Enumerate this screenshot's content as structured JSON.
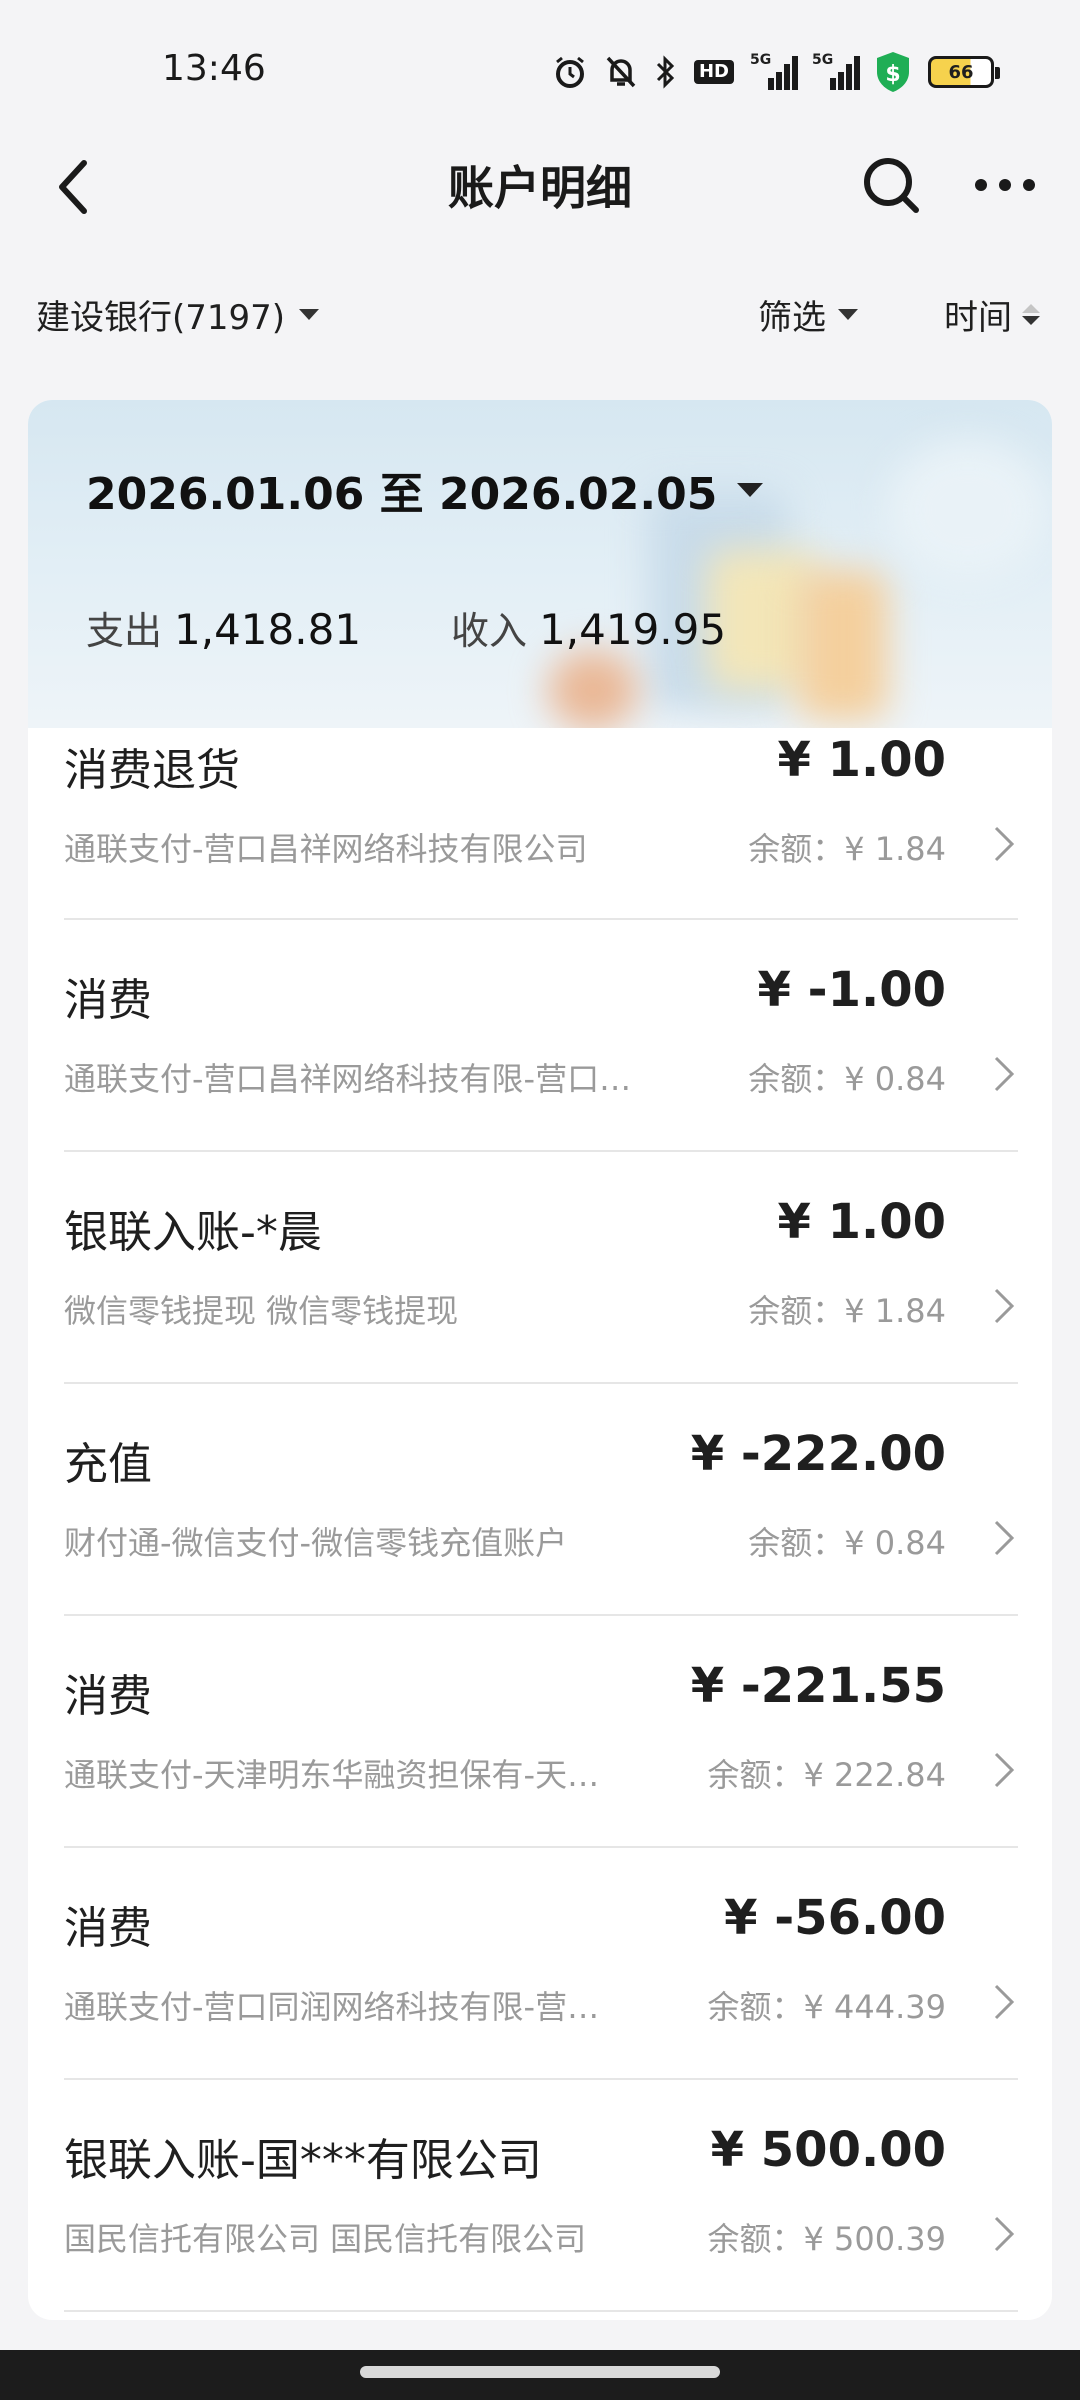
{
  "status_bar": {
    "time": "13:46",
    "battery": "66",
    "network1": "5G",
    "network2": "5G",
    "hd": "HD"
  },
  "header": {
    "title": "账户明细"
  },
  "filters": {
    "account": "建设银行(7197)",
    "filter_label": "筛选",
    "time_label": "时间"
  },
  "summary": {
    "date_range": "2026.01.06 至 2026.02.05",
    "expense_label": "支出",
    "expense_value": "1,418.81",
    "income_label": "收入",
    "income_value": "1,419.95"
  },
  "transactions": [
    {
      "title": "消费退货",
      "amount": "¥ 1.00",
      "desc": "通联支付-营口昌祥网络科技有限公司",
      "balance": "余额：¥ 1.84"
    },
    {
      "title": "消费",
      "amount": "¥ -1.00",
      "desc": "通联支付-营口昌祥网络科技有限-营口…",
      "balance": "余额：¥ 0.84"
    },
    {
      "title": "银联入账-*晨",
      "amount": "¥ 1.00",
      "desc": "微信零钱提现 微信零钱提现",
      "balance": "余额：¥ 1.84"
    },
    {
      "title": "充值",
      "amount": "¥ -222.00",
      "desc": "财付通-微信支付-微信零钱充值账户",
      "balance": "余额：¥ 0.84"
    },
    {
      "title": "消费",
      "amount": "¥ -221.55",
      "desc": "通联支付-天津明东华融资担保有-天津…",
      "balance": "余额：¥ 222.84"
    },
    {
      "title": "消费",
      "amount": "¥ -56.00",
      "desc": "通联支付-营口同润网络科技有限-营口…",
      "balance": "余额：¥ 444.39"
    },
    {
      "title": "银联入账-国***有限公司",
      "amount": "¥ 500.00",
      "desc": "国民信托有限公司 国民信托有限公司",
      "balance": "余额：¥ 500.39"
    }
  ],
  "colors": {
    "background": "#f4f4f6",
    "summary_gradient_top": "#d6e7f1",
    "text_primary": "#1f1f1f",
    "text_secondary": "#9a9a9a",
    "shield_green": "#1fae55",
    "battery_yellow": "#f6d24d"
  },
  "icons": {
    "back": "chevron-left-icon",
    "search": "search-icon",
    "more": "more-horizontal-icon",
    "row_chevron": "chevron-right-icon"
  }
}
